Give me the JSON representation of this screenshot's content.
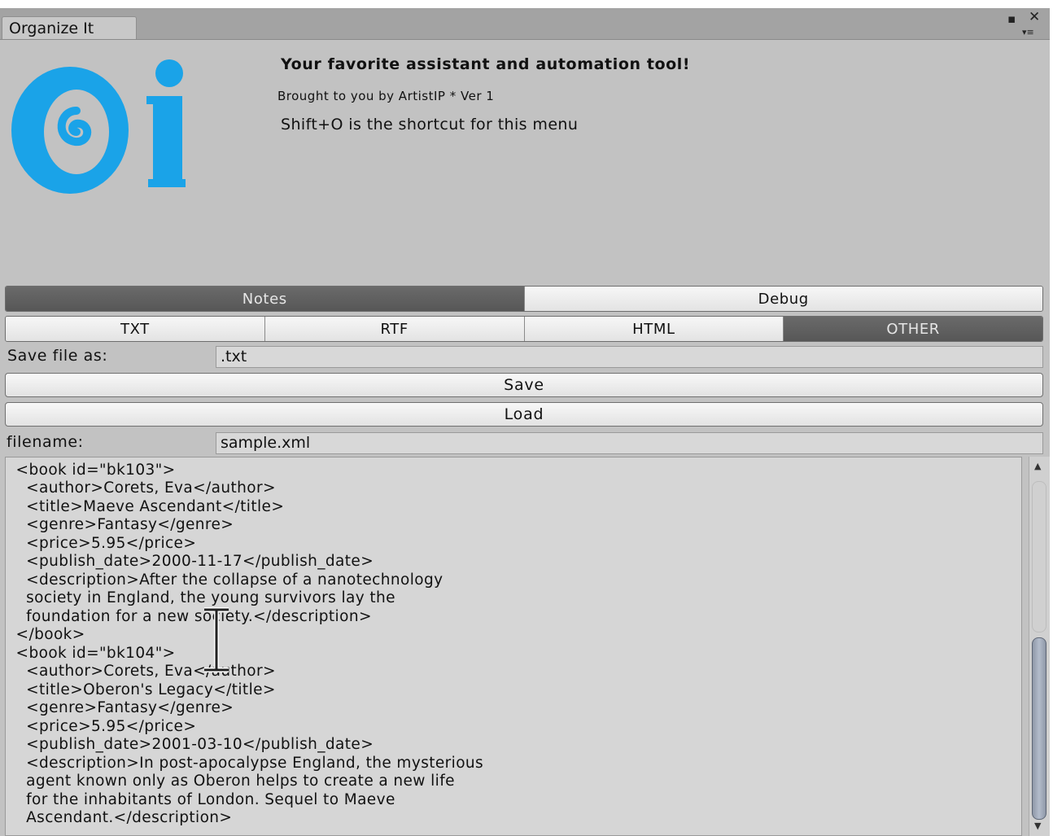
{
  "window": {
    "tab_title": "Organize It"
  },
  "header": {
    "logo_text": "Oi",
    "headline": "Your favorite assistant and automation tool!",
    "byline": "Brought to you by ArtistIP * Ver 1",
    "shortcut": "Shift+O is the shortcut for this menu"
  },
  "mode_tabs": [
    {
      "label": "Notes",
      "active": true
    },
    {
      "label": "Debug",
      "active": false
    }
  ],
  "format_tabs": [
    {
      "label": "TXT",
      "active": false
    },
    {
      "label": "RTF",
      "active": false
    },
    {
      "label": "HTML",
      "active": false
    },
    {
      "label": "OTHER",
      "active": true
    }
  ],
  "save_as": {
    "label": "Save file as:",
    "value": ".txt"
  },
  "buttons": {
    "save": "Save",
    "load": "Load"
  },
  "filename": {
    "label": "filename:",
    "value": "sample.xml"
  },
  "editor": {
    "content": "  </book>\n  <book id=\"bk103\">\n    <author>Corets, Eva</author>\n    <title>Maeve Ascendant</title>\n    <genre>Fantasy</genre>\n    <price>5.95</price>\n    <publish_date>2000-11-17</publish_date>\n    <description>After the collapse of a nanotechnology\n    society in England, the young survivors lay the\n    foundation for a new society.</description>\n  </book>\n  <book id=\"bk104\">\n    <author>Corets, Eva</author>\n    <title>Oberon's Legacy</title>\n    <genre>Fantasy</genre>\n    <price>5.95</price>\n    <publish_date>2001-03-10</publish_date>\n    <description>In post-apocalypse England, the mysterious\n    agent known only as Oberon helps to create a new life\n    for the inhabitants of London. Sequel to Maeve\n    Ascendant.</description>"
  },
  "colors": {
    "logo": "#1aa3e8",
    "active_tab": "#5e5e5e",
    "panel": "#c2c2c2"
  }
}
